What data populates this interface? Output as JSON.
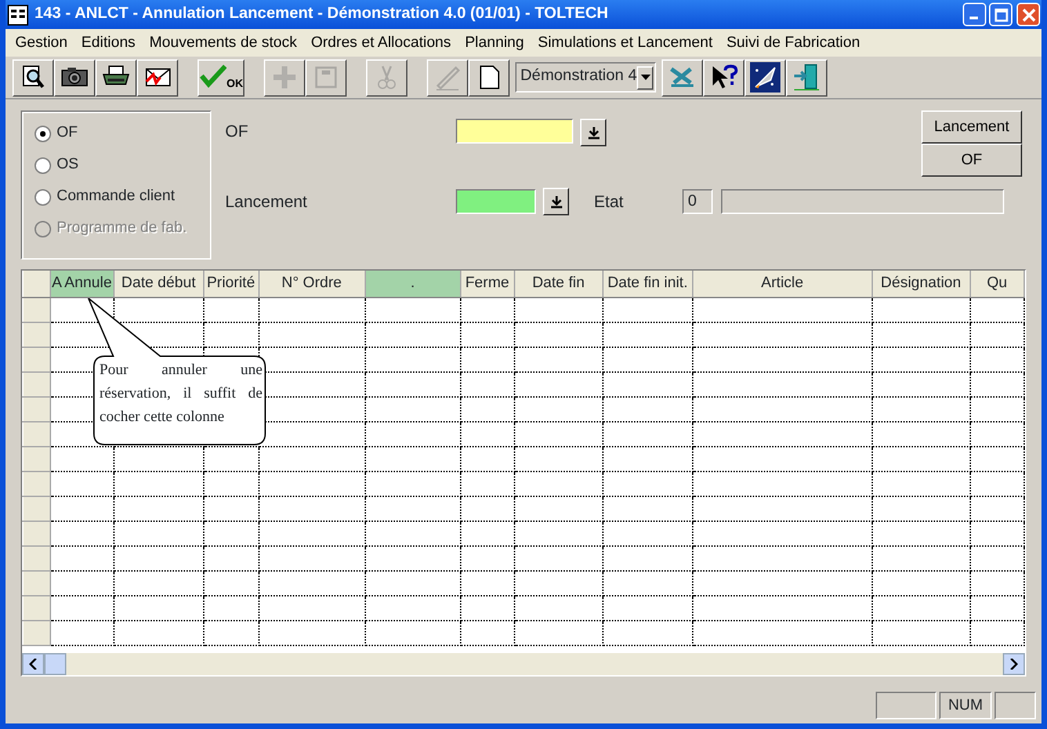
{
  "window": {
    "title": "143 - ANLCT - Annulation Lancement - Démonstration 4.0 (01/01) - TOLTECH"
  },
  "menu": [
    "Gestion",
    "Editions",
    "Mouvements de stock",
    "Ordres et Allocations",
    "Planning",
    "Simulations et Lancement",
    "Suivi de Fabrication"
  ],
  "toolbar": [
    {
      "kind": "preview",
      "disabled": false
    },
    {
      "kind": "camera",
      "disabled": false
    },
    {
      "kind": "printer",
      "disabled": false
    },
    {
      "kind": "envelope",
      "disabled": false
    },
    {
      "kind": "gap"
    },
    {
      "kind": "ok",
      "label": "OK",
      "disabled": false
    },
    {
      "kind": "gap"
    },
    {
      "kind": "plus",
      "disabled": true
    },
    {
      "kind": "save",
      "disabled": true
    },
    {
      "kind": "gap"
    },
    {
      "kind": "scissors",
      "disabled": true
    },
    {
      "kind": "gap"
    },
    {
      "kind": "pencil",
      "disabled": true
    },
    {
      "kind": "page",
      "disabled": false
    },
    {
      "kind": "dropdown",
      "value": "Démonstration 4"
    },
    {
      "kind": "tools",
      "disabled": false
    },
    {
      "kind": "help",
      "disabled": false
    },
    {
      "kind": "rocket",
      "disabled": false
    },
    {
      "kind": "exit",
      "disabled": false
    }
  ],
  "source_options": [
    {
      "label": "OF",
      "selected": true,
      "disabled": false
    },
    {
      "label": "OS",
      "selected": false,
      "disabled": false
    },
    {
      "label": "Commande client",
      "selected": false,
      "disabled": false
    },
    {
      "label": "Programme de fab.",
      "selected": false,
      "disabled": true
    }
  ],
  "fields": [
    {
      "label": "OF",
      "color": "#ffff99"
    },
    {
      "label": "Lancement",
      "color": "#80f080"
    }
  ],
  "etat": {
    "label": "Etat",
    "code": "0"
  },
  "side_buttons": [
    "Lancement",
    "OF"
  ],
  "table": {
    "columns": [
      {
        "label": "A Annule",
        "highlighted": true
      },
      {
        "label": "Date début",
        "highlighted": false
      },
      {
        "label": "Priorité",
        "highlighted": false
      },
      {
        "label": "N° Ordre",
        "highlighted": false
      },
      {
        "label": ".",
        "highlighted": true
      },
      {
        "label": "Ferme",
        "highlighted": false
      },
      {
        "label": "Date fin",
        "highlighted": false
      },
      {
        "label": "Date fin init.",
        "highlighted": false
      },
      {
        "label": "Article",
        "highlighted": false
      },
      {
        "label": "Désignation",
        "highlighted": false
      },
      {
        "label": "Qu",
        "highlighted": false
      }
    ]
  },
  "callout": "Pour annuler une réservation, il suffit de cocher cette colonne",
  "status_bar": {
    "indicator": "NUM"
  }
}
